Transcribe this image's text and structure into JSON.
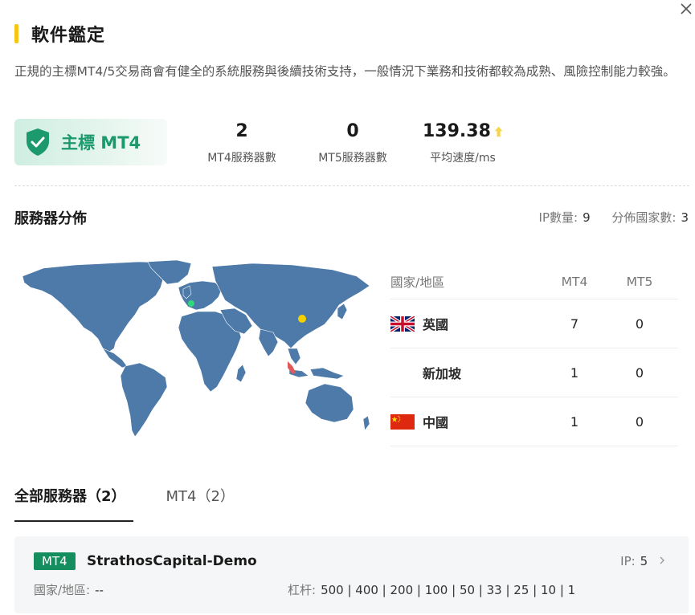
{
  "header": {
    "title": "軟件鑑定",
    "close_icon": "close-icon"
  },
  "description": "正規的主標MT4/5交易商會有健全的系統服務與後續技術支持，一般情況下業務和技術都較為成熟、風險控制能力較強。",
  "badge": {
    "label": "主標 MT4",
    "icon": "shield-check-icon",
    "color": "#1c9a6e"
  },
  "stats": [
    {
      "value": "2",
      "label": "MT4服務器數"
    },
    {
      "value": "0",
      "label": "MT5服務器數"
    },
    {
      "value": "139.38",
      "label": "平均速度/ms",
      "icon": "arrow-up-icon"
    }
  ],
  "distribution": {
    "title": "服務器分佈",
    "ip_label": "IP數量:",
    "ip_value": "9",
    "countries_label": "分佈國家數:",
    "countries_value": "3",
    "table": {
      "headers": [
        "國家/地區",
        "MT4",
        "MT5"
      ],
      "rows": [
        {
          "flag": "uk-flag-icon",
          "name": "英國",
          "mt4": "7",
          "mt5": "0"
        },
        {
          "flag": "",
          "name": "新加坡",
          "mt4": "1",
          "mt5": "0"
        },
        {
          "flag": "china-flag-icon",
          "name": "中國",
          "mt4": "1",
          "mt5": "0"
        }
      ]
    },
    "map_markers": [
      "uk-marker",
      "china-marker",
      "singapore-marker"
    ]
  },
  "tabs": [
    {
      "label": "全部服務器（2）",
      "active": true
    },
    {
      "label": "MT4（2）",
      "active": false
    }
  ],
  "servers": [
    {
      "tag": "MT4",
      "name": "StrathosCapital-Demo",
      "ip_label": "IP:",
      "ip_value": "5",
      "country_label": "國家/地區:",
      "country_value": "--",
      "leverage_label": "杠杆:",
      "leverage_value": "500 | 400 | 200 | 100 | 50 | 33 | 25 | 10 | 1"
    }
  ],
  "colors": {
    "accent": "#f5c518",
    "brand_green": "#148e5f",
    "map_land": "#4d7aa8"
  }
}
